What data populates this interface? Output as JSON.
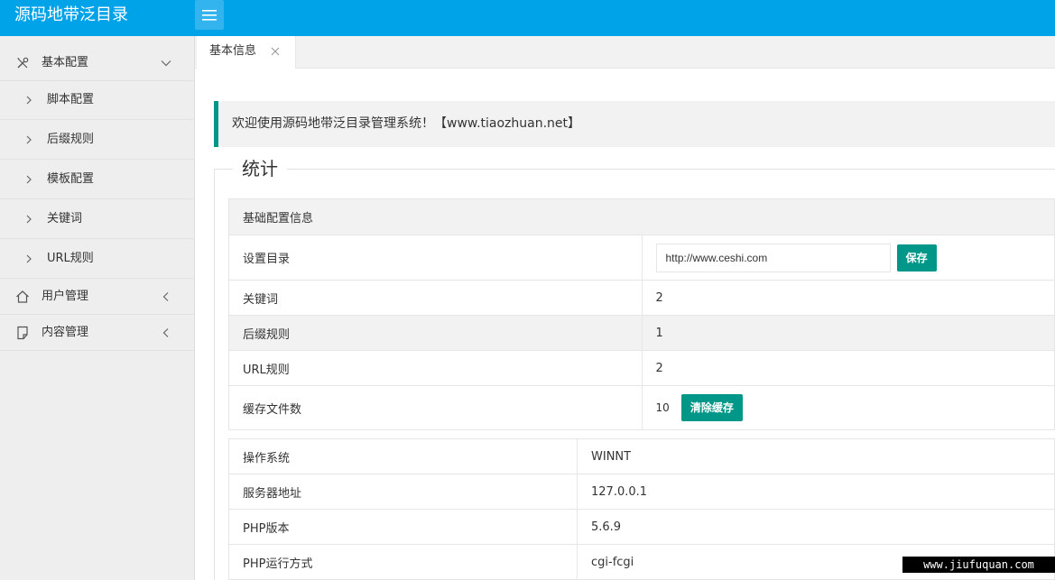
{
  "app": {
    "title": "源码地带泛目录"
  },
  "sidebar": {
    "groups": [
      {
        "label": "基本配置",
        "icon": "wrench-screwdriver-icon",
        "expanded": true
      },
      {
        "label": "用户管理",
        "icon": "home-icon",
        "expanded": false
      },
      {
        "label": "内容管理",
        "icon": "document-icon",
        "expanded": false
      }
    ],
    "items": [
      {
        "label": "脚本配置"
      },
      {
        "label": "后缀规则"
      },
      {
        "label": "模板配置"
      },
      {
        "label": "关键词"
      },
      {
        "label": "URL规则"
      }
    ]
  },
  "tabs": [
    {
      "label": "基本信息",
      "active": true
    }
  ],
  "welcome": {
    "text": "欢迎使用源码地带泛目录管理系统！【www.tiaozhuan.net】"
  },
  "stats": {
    "legend": "统计",
    "config_header": "基础配置信息",
    "config_rows": [
      {
        "label": "设置目录",
        "value": "http://www.ceshi.com",
        "button": "保存"
      },
      {
        "label": "关键词",
        "value": "2"
      },
      {
        "label": "后缀规则",
        "value": "1"
      },
      {
        "label": "URL规则",
        "value": "2"
      },
      {
        "label": "缓存文件数",
        "value": "10",
        "button": "清除缓存"
      }
    ],
    "server_rows": [
      {
        "label": "操作系统",
        "value": "WINNT"
      },
      {
        "label": "服务器地址",
        "value": "127.0.0.1"
      },
      {
        "label": "PHP版本",
        "value": "5.6.9"
      },
      {
        "label": "PHP运行方式",
        "value": "cgi-fcgi"
      }
    ]
  },
  "watermark": "www.jiufuquan.com",
  "colors": {
    "topbar": "#00a2e8",
    "accent": "#009688",
    "sidebar_bg": "#eeeeee"
  }
}
